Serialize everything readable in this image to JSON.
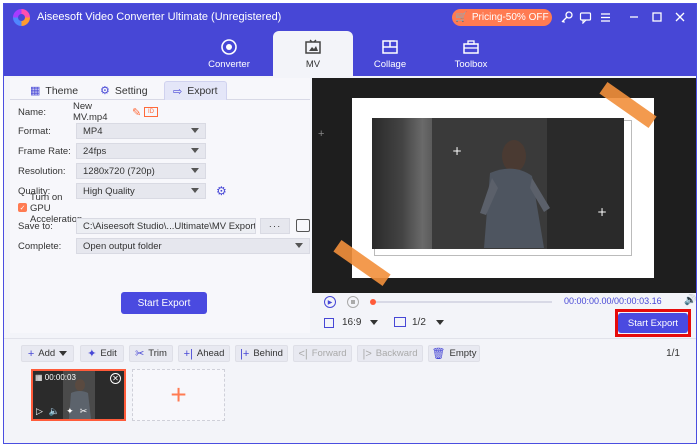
{
  "window": {
    "title": "Aiseesoft Video Converter Ultimate (Unregistered)",
    "pricing_label": "Pricing-50% OFF"
  },
  "nav": {
    "tabs": [
      {
        "label": "Converter",
        "icon": "converter-icon"
      },
      {
        "label": "MV",
        "icon": "mv-icon",
        "active": true
      },
      {
        "label": "Collage",
        "icon": "collage-icon"
      },
      {
        "label": "Toolbox",
        "icon": "toolbox-icon"
      }
    ]
  },
  "panel_tabs": {
    "theme": "Theme",
    "setting": "Setting",
    "export": "Export"
  },
  "export_settings": {
    "name_label": "Name:",
    "name_value": "New MV.mp4",
    "format_label": "Format:",
    "format_value": "MP4",
    "frame_rate_label": "Frame Rate:",
    "frame_rate_value": "24fps",
    "resolution_label": "Resolution:",
    "resolution_value": "1280x720 (720p)",
    "quality_label": "Quality:",
    "quality_value": "High Quality",
    "gpu_label": "Turn on GPU Acceleration",
    "gpu_checked": true,
    "save_to_label": "Save to:",
    "save_to_value": "C:\\Aiseesoft Studio\\...Ultimate\\MV Exported",
    "complete_label": "Complete:",
    "complete_value": "Open output folder",
    "start_export_label": "Start Export"
  },
  "player": {
    "time_readout": "00:00:00.00/00:00:03.16",
    "aspect_ratio": "16:9",
    "page": "1/2",
    "start_export_label": "Start Export"
  },
  "toolbar": {
    "add": "Add",
    "edit": "Edit",
    "trim": "Trim",
    "ahead": "Ahead",
    "behind": "Behind",
    "forward": "Forward",
    "backward": "Backward",
    "empty": "Empty",
    "page_count": "1/1"
  },
  "clips": {
    "clip1_time": "00:00:03"
  },
  "colors": {
    "accent": "#4747d6",
    "orange": "#ff7b52",
    "highlight": "#e60b0b"
  }
}
